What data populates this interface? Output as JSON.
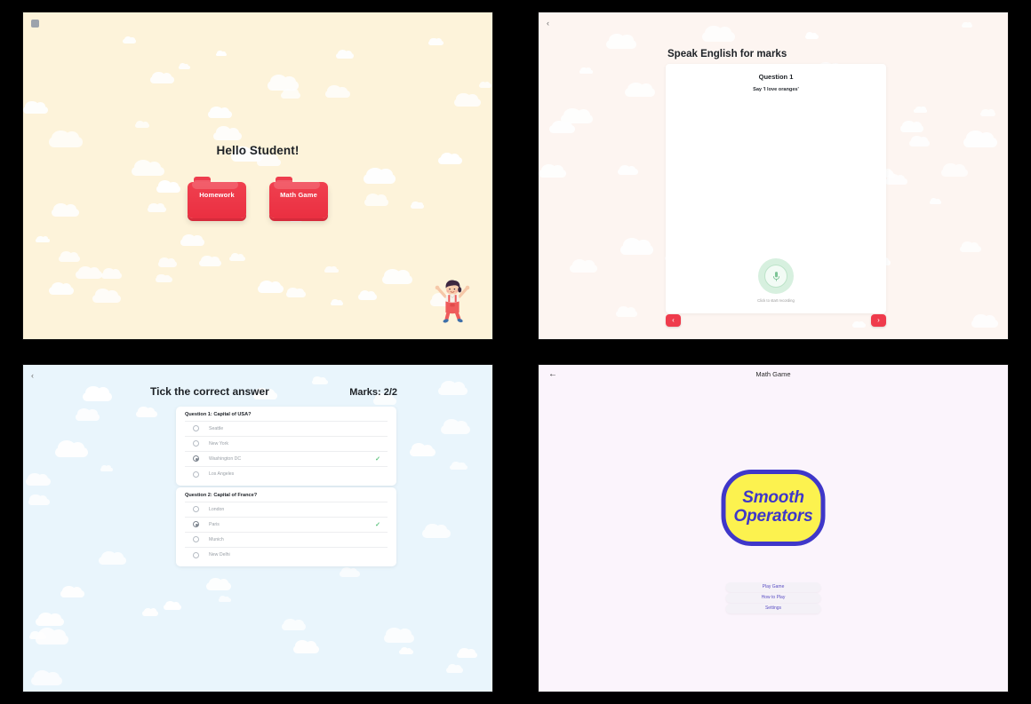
{
  "panels": {
    "home": {
      "name": "Student Home",
      "title": "Hello Student!",
      "corner_icon": "app-icon",
      "folders": [
        {
          "label": "Homework",
          "icon": "folder-icon",
          "color": "#ee3d4d"
        },
        {
          "label": "Math Game",
          "icon": "folder-icon",
          "color": "#ee3d4d"
        }
      ],
      "character": "jumping-child-illustration",
      "background_color": "#FDF3DA"
    },
    "speak": {
      "name": "Speak English for marks",
      "back_icon": "chevron-left-icon",
      "title": "Speak English for marks",
      "question_number": "Question 1",
      "prompt": "Say 'I love oranges'",
      "mic_icon": "microphone-icon",
      "mic_hint": "Click to start recording",
      "prev_label": "‹",
      "next_label": "›",
      "background_color": "#FDF5F1",
      "accent_color": "#EF3B4C",
      "mic_color": "#D7F0DF"
    },
    "quiz": {
      "name": "Tick the correct answer",
      "back_icon": "chevron-left-icon",
      "title": "Tick the correct answer",
      "marks_label": "Marks: 2/2",
      "background_color": "#E9F5FC",
      "tick_glyph": "✓",
      "questions": [
        {
          "heading": "Question 1: Capital of USA?",
          "options": [
            {
              "label": "Seattle",
              "selected": false,
              "correct": false
            },
            {
              "label": "New York",
              "selected": false,
              "correct": false
            },
            {
              "label": "Washington DC",
              "selected": true,
              "correct": true
            },
            {
              "label": "Los Angeles",
              "selected": false,
              "correct": false
            }
          ]
        },
        {
          "heading": "Question 2: Capital of France?",
          "options": [
            {
              "label": "London",
              "selected": false,
              "correct": false
            },
            {
              "label": "Paris",
              "selected": true,
              "correct": true
            },
            {
              "label": "Munich",
              "selected": false,
              "correct": false
            },
            {
              "label": "New Delhi",
              "selected": false,
              "correct": false
            }
          ]
        }
      ]
    },
    "math": {
      "name": "Math Game",
      "back_icon": "arrow-left-icon",
      "title": "Math Game",
      "logo_line_1": "Smooth",
      "logo_line_2": "Operators",
      "logo_fill": "#FCF24F",
      "logo_stroke": "#3F37C9",
      "background_color": "#FBF4FC",
      "menu": [
        {
          "label": "Play Game"
        },
        {
          "label": "How to Play"
        },
        {
          "label": "Settings"
        }
      ]
    }
  }
}
